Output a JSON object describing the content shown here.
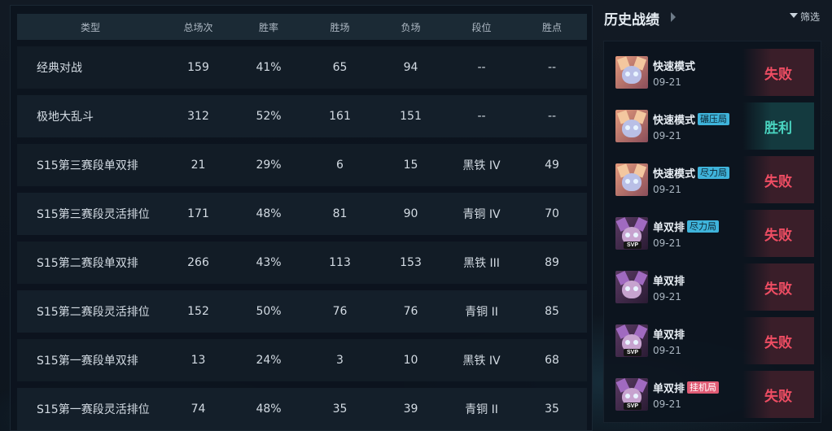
{
  "stats": {
    "headers": {
      "type": "类型",
      "total": "总场次",
      "rate": "胜率",
      "wins": "胜场",
      "losses": "负场",
      "rank": "段位",
      "points": "胜点"
    },
    "rows": [
      {
        "type": "经典对战",
        "total": "159",
        "rate": "41%",
        "wins": "65",
        "losses": "94",
        "rank": "--",
        "points": "--"
      },
      {
        "type": "极地大乱斗",
        "total": "312",
        "rate": "52%",
        "wins": "161",
        "losses": "151",
        "rank": "--",
        "points": "--"
      },
      {
        "type": "S15第三赛段单双排",
        "total": "21",
        "rate": "29%",
        "wins": "6",
        "losses": "15",
        "rank": "黑铁 IV",
        "points": "49"
      },
      {
        "type": "S15第三赛段灵活排位",
        "total": "171",
        "rate": "48%",
        "wins": "81",
        "losses": "90",
        "rank": "青铜 IV",
        "points": "70"
      },
      {
        "type": "S15第二赛段单双排",
        "total": "266",
        "rate": "43%",
        "wins": "113",
        "losses": "153",
        "rank": "黑铁 III",
        "points": "89"
      },
      {
        "type": "S15第二赛段灵活排位",
        "total": "152",
        "rate": "50%",
        "wins": "76",
        "losses": "76",
        "rank": "青铜 II",
        "points": "85"
      },
      {
        "type": "S15第一赛段单双排",
        "total": "13",
        "rate": "24%",
        "wins": "3",
        "losses": "10",
        "rank": "黑铁 IV",
        "points": "68"
      },
      {
        "type": "S15第一赛段灵活排位",
        "total": "74",
        "rate": "48%",
        "wins": "35",
        "losses": "39",
        "rank": "青铜 II",
        "points": "35"
      }
    ]
  },
  "history": {
    "title": "历史战绩",
    "filter_label": "筛选",
    "matches": [
      {
        "mode": "快速模式",
        "tag": "",
        "date": "09-21",
        "result": "失败",
        "avatar": "yuumi-icon",
        "svp": ""
      },
      {
        "mode": "快速模式",
        "tag": "碾压局",
        "date": "09-21",
        "result": "胜利",
        "avatar": "yuumi-icon",
        "svp": ""
      },
      {
        "mode": "快速模式",
        "tag": "尽力局",
        "date": "09-21",
        "result": "失败",
        "avatar": "yuumi-icon",
        "svp": ""
      },
      {
        "mode": "单双排",
        "tag": "尽力局",
        "date": "09-21",
        "result": "失败",
        "avatar": "champion-icon",
        "svp": "SVP"
      },
      {
        "mode": "单双排",
        "tag": "",
        "date": "09-21",
        "result": "失败",
        "avatar": "champion-icon",
        "svp": ""
      },
      {
        "mode": "单双排",
        "tag": "",
        "date": "09-21",
        "result": "失败",
        "avatar": "champion-icon",
        "svp": "SVP"
      },
      {
        "mode": "单双排",
        "tag": "挂机局",
        "date": "09-21",
        "result": "失败",
        "avatar": "champion-icon",
        "svp": "SVP"
      }
    ]
  },
  "colors": {
    "win": "#4ad4c0",
    "loss": "#ee4d63",
    "tag_blue": "#3fb4db",
    "tag_red": "#e05b74"
  }
}
